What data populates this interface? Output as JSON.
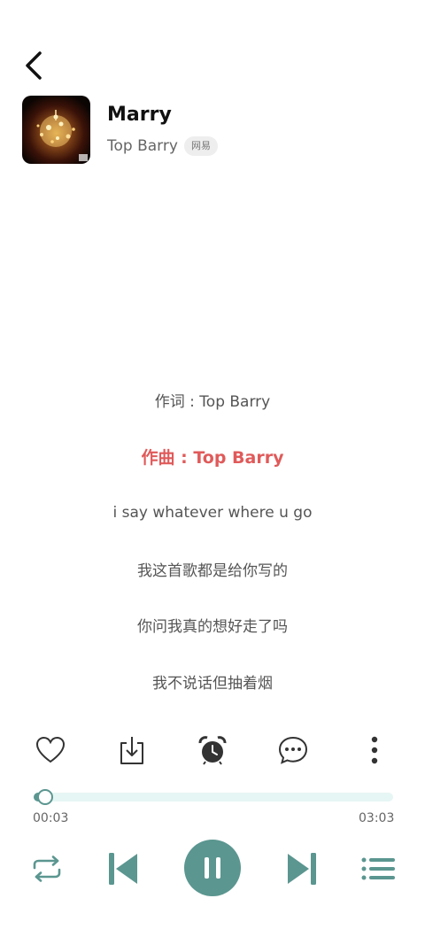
{
  "header": {
    "back_icon": "chevron-left-icon"
  },
  "song": {
    "title": "Marry",
    "artist": "Top Barry",
    "source_badge": "网易"
  },
  "lyrics": [
    {
      "text": "作词 : Top Barry",
      "active": false
    },
    {
      "text": "作曲 : Top Barry",
      "active": true
    },
    {
      "text": "i say whatever where u go",
      "active": false
    },
    {
      "text": "我这首歌都是给你写的",
      "active": false
    },
    {
      "text": "你问我真的想好走了吗",
      "active": false
    },
    {
      "text": "我不说话但抽着烟",
      "active": false
    }
  ],
  "actions": [
    "heart-icon",
    "download-icon",
    "alarm-clock-icon",
    "comment-icon",
    "more-vertical-icon"
  ],
  "progress": {
    "current_time": "00:03",
    "total_time": "03:03",
    "fraction": 0.016
  },
  "controls": [
    "repeat-icon",
    "previous-icon",
    "pause-icon",
    "next-icon",
    "playlist-icon"
  ],
  "colors": {
    "accent": "#5b9690",
    "active_lyric": "#e05a5a",
    "track": "#e6f6f4"
  }
}
